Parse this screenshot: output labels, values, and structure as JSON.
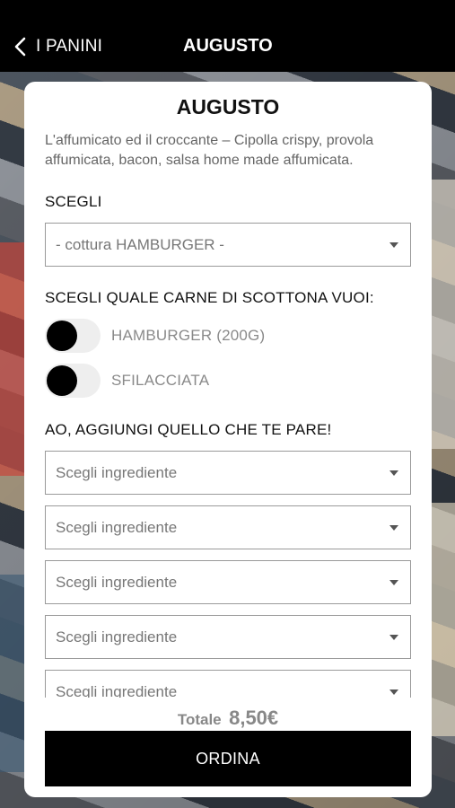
{
  "topbar": {
    "back_label": "I PANINI",
    "title": "AUGUSTO"
  },
  "card": {
    "title": "AUGUSTO",
    "description": "L'affumicato ed il croccante – Cipolla crispy, provola affumicata, bacon, salsa home made affumicata.",
    "choose_label": "SCEGLI",
    "cooking_select": "- cottura HAMBURGER -",
    "meat_label": "SCEGLI QUALE CARNE DI SCOTTONA VUOI:",
    "meat_options": [
      {
        "label": "HAMBURGER (200G)",
        "selected": false
      },
      {
        "label": "SFILACCIATA",
        "selected": false
      }
    ],
    "extras_label": "AO, AGGIUNGI QUELLO CHE TE PARE!",
    "ingredient_selects": [
      "Scegli ingrediente",
      "Scegli ingrediente",
      "Scegli ingrediente",
      "Scegli ingrediente",
      "Scegli ingrediente"
    ],
    "total_label": "Totale",
    "total_value": "8,50€",
    "order_button": "ORDINA"
  },
  "icons": {
    "back": "chevron-left-icon",
    "dropdown": "caret-down-icon"
  },
  "colors": {
    "topbar_bg": "#000000",
    "button_bg": "#000000",
    "toggle_knob": "#000000",
    "toggle_track": "#eeeeee"
  }
}
